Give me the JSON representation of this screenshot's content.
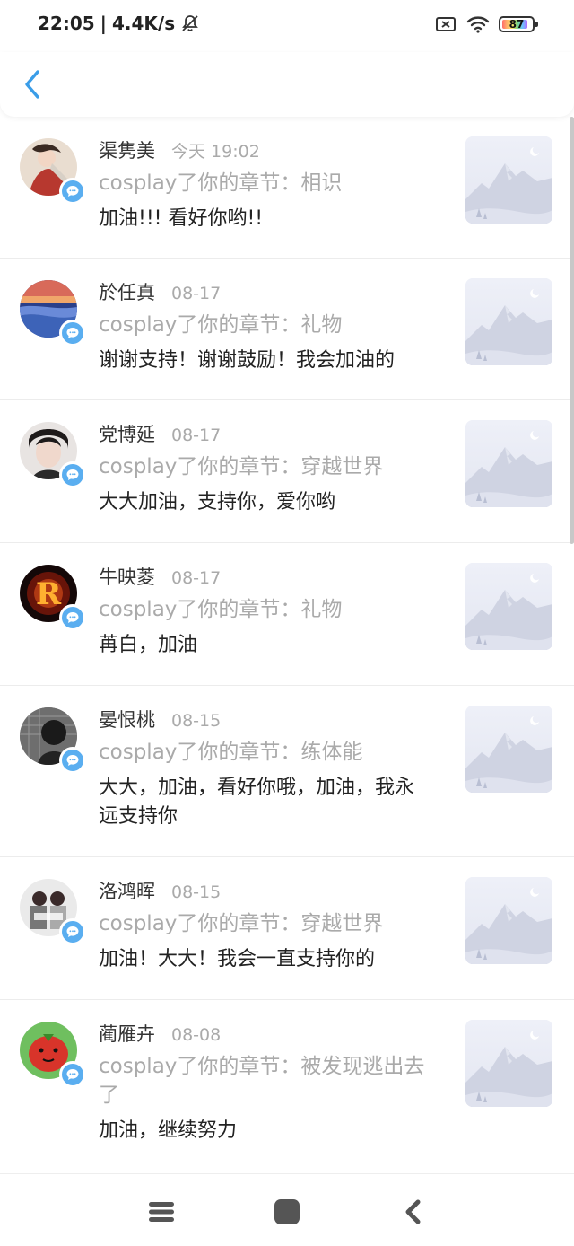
{
  "status_bar": {
    "time": "22:05",
    "separator": "|",
    "network_speed": "4.4K/s",
    "battery": "87",
    "icons": [
      "bell-off-icon",
      "sim-off-icon",
      "wifi-icon",
      "battery-icon"
    ]
  },
  "header": {
    "back_icon": "chevron-left-icon",
    "accent_color": "#3a9de8"
  },
  "colors": {
    "badge": "#5aaef0",
    "muted_text": "#aaaaaa"
  },
  "items": [
    {
      "name": "渠隽美",
      "time": "今天 19:02",
      "ref": "cosplay了你的章节：相识",
      "comment": "加油!!! 看好你哟!!"
    },
    {
      "name": "於任真",
      "time": "08-17",
      "ref": "cosplay了你的章节：礼物",
      "comment": "谢谢支持！谢谢鼓励！我会加油的"
    },
    {
      "name": "党博延",
      "time": "08-17",
      "ref": "cosplay了你的章节：穿越世界",
      "comment": "大大加油，支持你，爱你哟"
    },
    {
      "name": "牛映菱",
      "time": "08-17",
      "ref": "cosplay了你的章节：礼物",
      "comment": "苒白，加油"
    },
    {
      "name": "晏恨桃",
      "time": "08-15",
      "ref": "cosplay了你的章节：练体能",
      "comment": "大大，加油，看好你哦，加油，我永远支持你"
    },
    {
      "name": "洛鸿晖",
      "time": "08-15",
      "ref": "cosplay了你的章节：穿越世界",
      "comment": "加油！大大！我会一直支持你的"
    },
    {
      "name": "蔺雁卉",
      "time": "08-08",
      "ref": "cosplay了你的章节：被发现逃出去了",
      "comment": "加油，继续努力"
    }
  ],
  "nav_bar": {
    "icons": [
      "menu-icon",
      "home-icon",
      "back-icon"
    ]
  }
}
